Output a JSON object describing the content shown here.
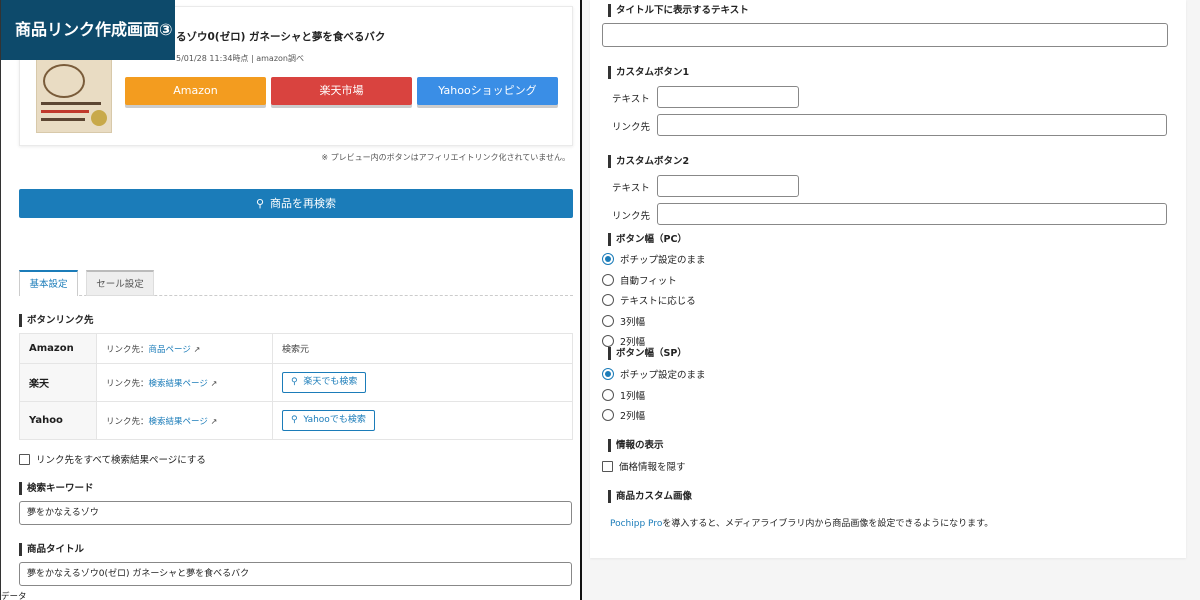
{
  "caption": "商品リンク作成画面③",
  "preview": {
    "title": "るゾウ0(ゼロ) ガネーシャと夢を食べるバク",
    "meta": "5/01/28 11:34時点 | amazon調べ",
    "buttons": [
      {
        "label": "Amazon",
        "color": "#f39c1f"
      },
      {
        "label": "楽天市場",
        "color": "#d9433f"
      },
      {
        "label": "Yahooショッピング",
        "color": "#3a8ee6"
      }
    ],
    "note": "※ プレビュー内のボタンはアフィリエイトリンク化されていません。"
  },
  "research_button": "商品を再検索",
  "tabs": [
    "基本設定",
    "セール設定"
  ],
  "link_section": {
    "heading": "ボタンリンク先",
    "search_header": "検索元",
    "link_prefix": "リンク先：",
    "rows": [
      {
        "store": "Amazon",
        "link": "商品ページ",
        "search": ""
      },
      {
        "store": "楽天",
        "link": "検索結果ページ",
        "search": "楽天でも検索"
      },
      {
        "store": "Yahoo",
        "link": "検索結果ページ",
        "search": "Yahooでも検索"
      }
    ]
  },
  "all_search_checkbox": "リンク先をすべて検索結果ページにする",
  "keyword": {
    "heading": "検索キーワード",
    "value": "夢をかなえるゾウ"
  },
  "product_title": {
    "heading": "商品タイトル",
    "value": "夢をかなえるゾウ0(ゼロ) ガネーシャと夢を食べるバク"
  },
  "cut_off_text": "データ",
  "right": {
    "subtitle_heading": "タイトル下に表示するテキスト",
    "custom1": {
      "heading": "カスタムボタン1",
      "text_label": "テキスト",
      "link_label": "リンク先"
    },
    "custom2": {
      "heading": "カスタムボタン2",
      "text_label": "テキスト",
      "link_label": "リンク先"
    },
    "width_pc": {
      "heading": "ボタン幅（PC）",
      "options": [
        "ポチップ設定のまま",
        "自動フィット",
        "テキストに応じる",
        "3列幅",
        "2列幅"
      ],
      "selected": 0
    },
    "width_sp": {
      "heading": "ボタン幅（SP）",
      "options": [
        "ポチップ設定のまま",
        "1列幅",
        "2列幅"
      ],
      "selected": 0
    },
    "info_heading": "情報の表示",
    "hide_price": "価格情報を隠す",
    "custom_image_heading": "商品カスタム画像",
    "pro_link": "Pochipp Pro",
    "pro_text": "を導入すると、メディアライブラリ内から商品画像を設定できるようになります。"
  }
}
